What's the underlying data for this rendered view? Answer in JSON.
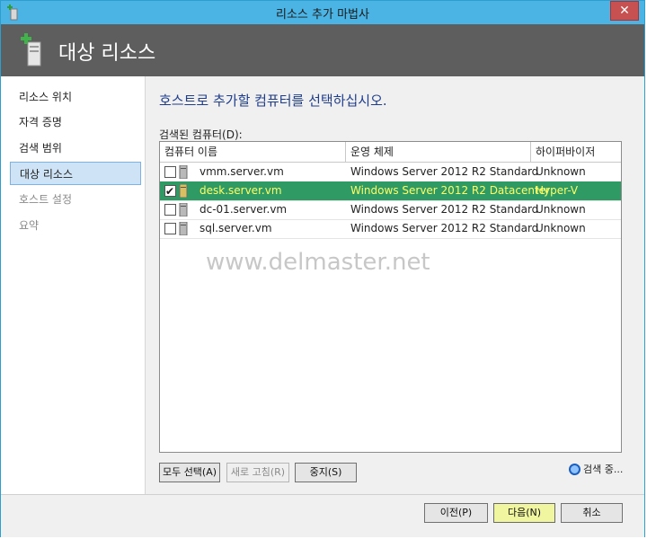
{
  "window": {
    "title": "리소스 추가 마법사",
    "close_glyph": "✕"
  },
  "header": {
    "title": "대상 리소스"
  },
  "sidebar": {
    "items": [
      {
        "label": "리소스 위치",
        "state": "normal"
      },
      {
        "label": "자격 증명",
        "state": "normal"
      },
      {
        "label": "검색 범위",
        "state": "normal"
      },
      {
        "label": "대상 리소스",
        "state": "active"
      },
      {
        "label": "호스트 설정",
        "state": "disabled"
      },
      {
        "label": "요약",
        "state": "disabled"
      }
    ]
  },
  "main": {
    "instruction": "호스트로 추가할 컴퓨터를 선택하십시오.",
    "found_label": "검색된 컴퓨터(D):",
    "columns": [
      "컴퓨터 이름",
      "운영 체제",
      "하이퍼바이저"
    ],
    "rows": [
      {
        "checked": false,
        "name": "vmm.server.vm",
        "os": "Windows Server 2012 R2 Standard",
        "hypervisor": "Unknown",
        "selected": false
      },
      {
        "checked": true,
        "name": "desk.server.vm",
        "os": "Windows Server 2012 R2 Datacenter",
        "hypervisor": "Hyper-V",
        "selected": true
      },
      {
        "checked": false,
        "name": "dc-01.server.vm",
        "os": "Windows Server 2012 R2 Standard",
        "hypervisor": "Unknown",
        "selected": false
      },
      {
        "checked": false,
        "name": "sql.server.vm",
        "os": "Windows Server 2012 R2 Standard",
        "hypervisor": "Unknown",
        "selected": false
      }
    ],
    "check_glyph": "✔",
    "watermark": "www.delmaster.net",
    "buttons": {
      "select_all": "모두 선택(A)",
      "refresh": "새로 고침(R)",
      "stop": "중지(S)"
    },
    "search_status": "검색 중..."
  },
  "footer": {
    "previous": "이전(P)",
    "next": "다음(N)",
    "cancel": "취소"
  },
  "colors": {
    "selected_row": "#2f9a64",
    "selected_text": "#ffff66",
    "header_bg": "#5e5e5e",
    "titlebar": "#4bb4e4"
  }
}
